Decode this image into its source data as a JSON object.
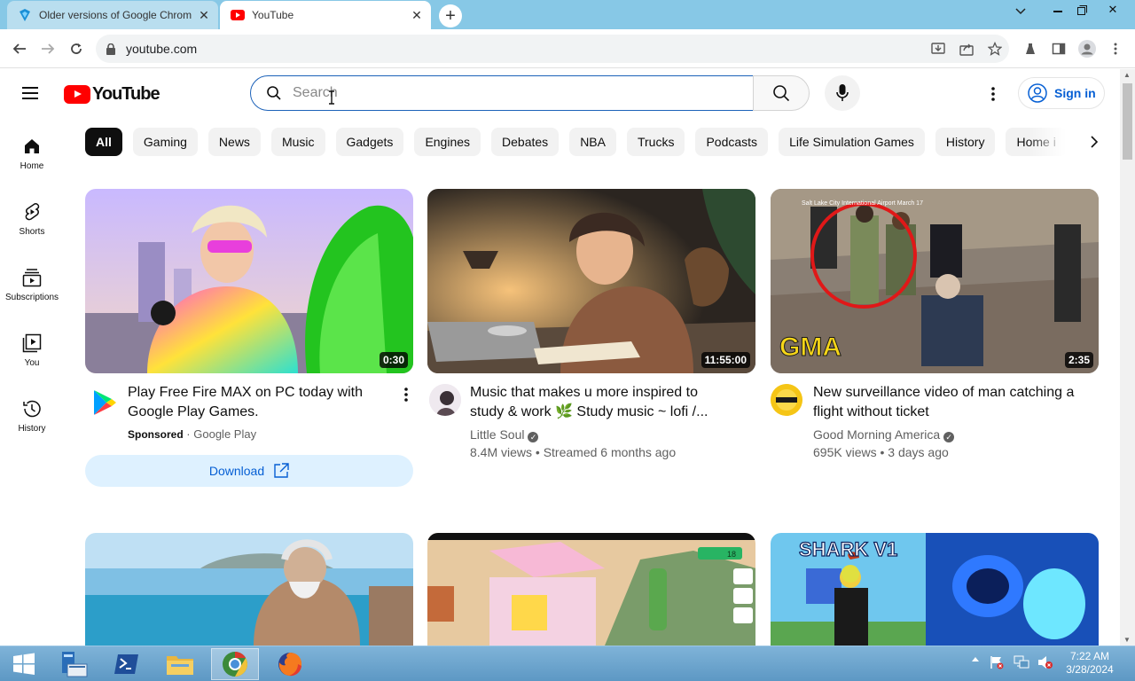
{
  "browser": {
    "tabs": [
      {
        "title": "Older versions of Google Chrom",
        "favicon": "chrome-versions-icon"
      },
      {
        "title": "YouTube",
        "favicon": "youtube-icon"
      }
    ],
    "url": "youtube.com"
  },
  "masthead": {
    "logo_text": "YouTube",
    "search_placeholder": "Search",
    "sign_in_label": "Sign in"
  },
  "guide": [
    {
      "label": "Home",
      "icon": "home-icon"
    },
    {
      "label": "Shorts",
      "icon": "shorts-icon"
    },
    {
      "label": "Subscriptions",
      "icon": "subscriptions-icon"
    },
    {
      "label": "You",
      "icon": "you-icon"
    },
    {
      "label": "History",
      "icon": "history-icon"
    }
  ],
  "chips": [
    "All",
    "Gaming",
    "News",
    "Music",
    "Gadgets",
    "Engines",
    "Debates",
    "NBA",
    "Trucks",
    "Podcasts",
    "Life Simulation Games",
    "History",
    "Home i"
  ],
  "videos": [
    {
      "title_line1": "Play Free Fire MAX on PC today with",
      "title_line2": "Google Play Games.",
      "sponsored": "Sponsored",
      "advertiser": "Google Play",
      "duration": "0:30",
      "action_label": "Download"
    },
    {
      "title_line1": "Music that makes u more inspired to",
      "title_line2": "study & work 🌿 Study music ~ lofi /...",
      "channel": "Little Soul",
      "stats": "8.4M views • Streamed 6 months ago",
      "duration": "11:55:00"
    },
    {
      "title_line1": "New surveillance video of man catching a",
      "title_line2": "flight without ticket",
      "channel": "Good Morning America",
      "stats": "695K views • 3 days ago",
      "duration": "2:35",
      "thumb_overlay_text": "GMA",
      "thumb_caption": "Salt Lake City International Airport March 17"
    }
  ],
  "row2": {
    "shark_title": "SHARK V1",
    "shop_price": "18"
  },
  "taskbar": {
    "time": "7:22 AM",
    "date": "3/28/2024"
  },
  "colors": {
    "youtube_red": "#ff0000",
    "link_blue": "#065fd4",
    "tab_strip": "#87c8e6",
    "taskbar": "#5d98c4"
  }
}
